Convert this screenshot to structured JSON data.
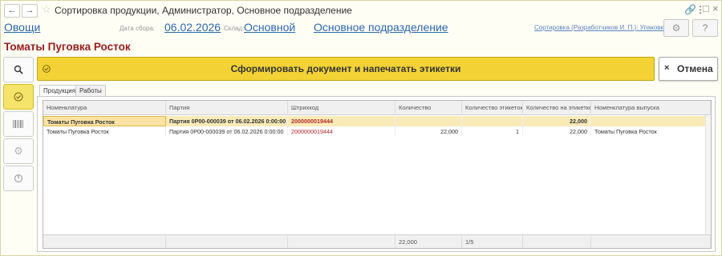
{
  "window": {
    "title": "Сортировка продукции, Администратор, Основное подразделение"
  },
  "header": {
    "vegetables_link": "Овощи",
    "date_label": "Дата сбора:",
    "date_value": "06.02.2026",
    "warehouse_label": "Склад:",
    "warehouse_value": "Основной",
    "division_link": "Основное подразделение",
    "right_link": "Сортировка (Разработчиков И. П.): Упаковка (..."
  },
  "document_title": "Томаты Пуговка Росток",
  "actions": {
    "form_print_label": "Сформировать документ и напечатать этикетки",
    "cancel_label": "Отмена"
  },
  "tabs": [
    {
      "label": "Продукция"
    },
    {
      "label": "Работы"
    }
  ],
  "table": {
    "columns": [
      "Номенклатура",
      "Партия",
      "Штрихкод",
      "Количество",
      "Количество этикеток",
      "Количество на этикетке",
      "Номенклатура выпуска"
    ],
    "rows": [
      {
        "nomenclature": "Томаты Пуговка Росток",
        "batch": "Партия 0P00-000039 от 06.02.2026 0:00:00",
        "barcode": "2000000019444",
        "quantity": "",
        "labels_count": "",
        "qty_per_label": "22,000",
        "output": ""
      },
      {
        "nomenclature": "Томаты Пуговка Росток",
        "batch": "Партия 0P00-000039 от 06.02.2026 0:00:00",
        "barcode": "2000000019444",
        "quantity": "22,000",
        "labels_count": "1",
        "qty_per_label": "22,000",
        "output": "Томаты Пуговка Росток"
      }
    ],
    "footer": {
      "quantity_total": "22,000",
      "labels_total": "1/5"
    }
  },
  "icons": {
    "back": "arrow-left-icon",
    "forward": "arrow-right-icon",
    "favorite": "star-icon",
    "link": "link-icon",
    "more": "more-icon",
    "maximize": "maximize-icon",
    "close": "close-icon",
    "settings": "gear-icon",
    "help": "help-icon"
  },
  "colors": {
    "accent_yellow": "#f2d234",
    "title_red": "#9b1a1a",
    "link_blue": "#2d67b0",
    "barcode_red": "#b62a2a",
    "selected_row": "#f8ebb8"
  }
}
